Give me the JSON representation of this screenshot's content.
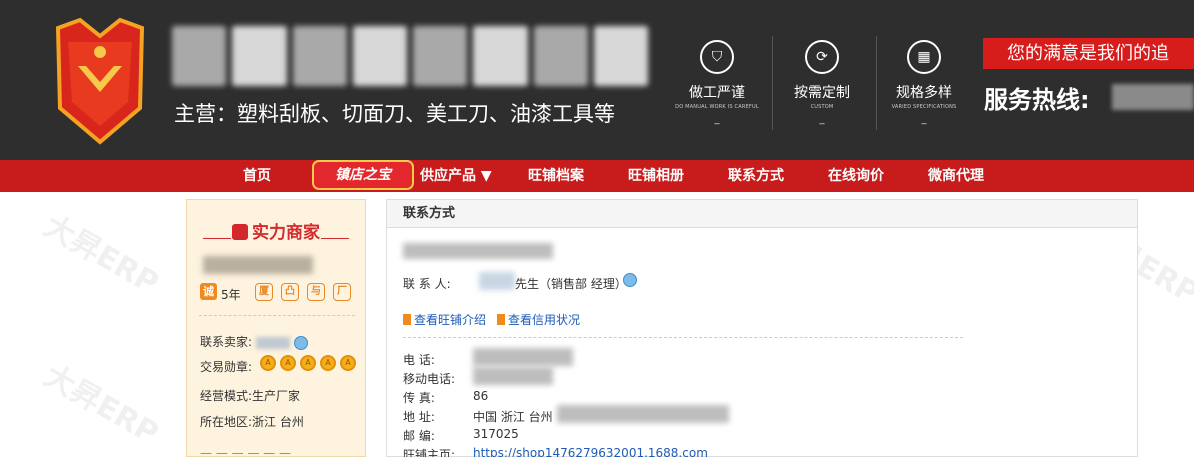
{
  "header": {
    "main_products": "主营：塑料刮板、切面刀、美工刀、油漆工具等",
    "features": [
      {
        "title": "做工严谨",
        "subtitle": "DO MANUAL WORK IS CAREFUL",
        "icon": "shield-icon"
      },
      {
        "title": "按需定制",
        "subtitle": "CUSTOM",
        "icon": "custom-icon"
      },
      {
        "title": "规格多样",
        "subtitle": "VARIED SPECIFICATIONS",
        "icon": "grid-icon"
      }
    ],
    "feature_dash": "_",
    "slogan": "您的满意是我们的追",
    "hotline_label": "服务热线:"
  },
  "nav": {
    "items": [
      "首页",
      "供应产品 ▼",
      "旺铺档案",
      "旺铺相册",
      "联系方式",
      "在线询价",
      "微商代理"
    ],
    "badge": "镇店之宝"
  },
  "watermark": "大昇ERP",
  "sidebar": {
    "title": "实力商家",
    "years": "5年",
    "badges": [
      "厦",
      "凸",
      "与",
      "厂"
    ],
    "contact_label": "联系卖家:",
    "medals_label": "交易勋章:",
    "medal_count": 5,
    "business_model": "经营模式:生产厂家",
    "location": "所在地区:浙江 台州"
  },
  "contact": {
    "header": "联系方式",
    "contact_person_label": "联 系 人:",
    "contact_person_suffix": "先生（销售部 经理）",
    "link_shop_intro": "查看旺铺介绍",
    "link_credit": "查看信用状况",
    "phone_label": "电    话:",
    "mobile_label": "移动电话:",
    "fax_label": "传    真:",
    "fax_value": "86",
    "address_label": "地    址:",
    "address_value": "中国 浙江 台州",
    "postcode_label": "邮    编:",
    "postcode_value": "317025",
    "shop_label": "旺铺主页:",
    "shop_url": "https://shop1476279632001.1688.com"
  },
  "colors": {
    "header_bg": "#2e2e2e",
    "nav_bg": "#c81b1b",
    "accent": "#d71c1c",
    "sidebar_bg": "#fdf3de",
    "link": "#1d5bb5"
  }
}
